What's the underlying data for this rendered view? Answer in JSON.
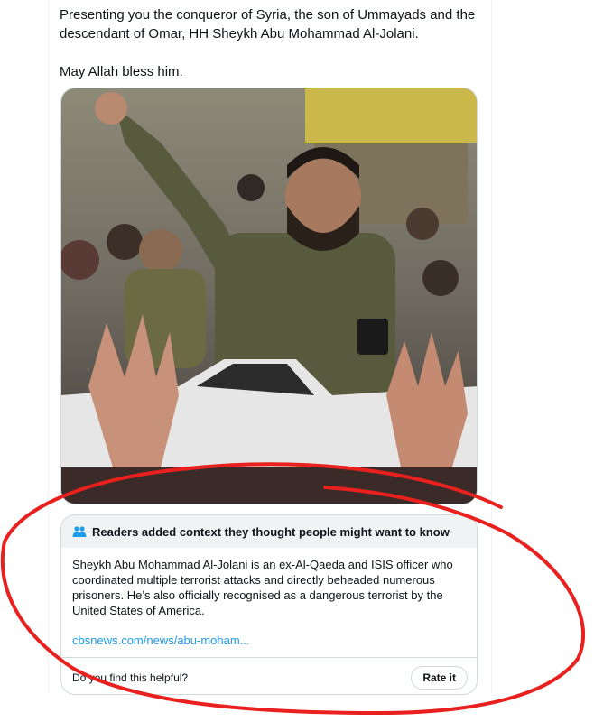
{
  "tweet": {
    "text_line1": "Presenting you the conqueror of Syria, the son of Ummayads and the",
    "text_line2": "descendant of Omar, HH Sheykh Abu Mohammad Al-Jolani.",
    "text_line3": "May Allah bless him."
  },
  "media": {
    "photo_icon": "photo"
  },
  "community_note": {
    "header_icon": "people-icon",
    "header": "Readers added context they thought people might want to know",
    "body": "Sheykh Abu Mohammad Al-Jolani is an ex-Al-Qaeda and ISIS officer who coordinated multiple terrorist attacks and directly beheaded numerous prisoners. He’s also officially recognised as a dangerous terrorist by the United States of America.",
    "link": "cbsnews.com/news/abu-moham...",
    "helpful_prompt": "Do you find this helpful?",
    "rate_button": "Rate it"
  },
  "annotation": {
    "color": "#e8201e"
  },
  "colors": {
    "link": "#1d9bf0",
    "border": "#cfd9de",
    "note_header_bg": "#eff3f4"
  }
}
